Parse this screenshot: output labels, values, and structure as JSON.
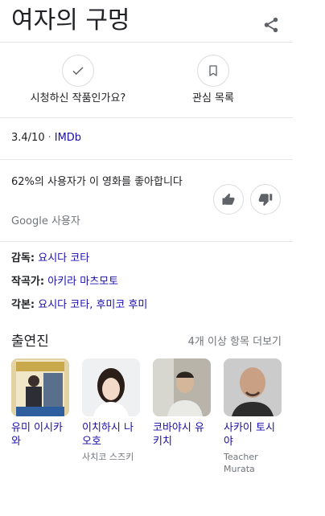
{
  "header": {
    "title": "여자의 구멍",
    "share_icon": "share-icon"
  },
  "actions": [
    {
      "label": "시청하신 작품인가요?",
      "icon": "checkmark-icon"
    },
    {
      "label": "관심 목록",
      "icon": "bookmark-icon"
    }
  ],
  "rating": {
    "score": "3.4/10",
    "separator": "·",
    "source": "IMDb"
  },
  "audience": {
    "text": "62%의 사용자가 이 영화를 좋아합니다",
    "source": "Google 사용자",
    "like_icon": "thumbs-up-icon",
    "dislike_icon": "thumbs-down-icon"
  },
  "credits": [
    {
      "key": "감독:",
      "value": "요시다 코타"
    },
    {
      "key": "작곡가:",
      "value": "아키라 마츠모토"
    },
    {
      "key": "각본:",
      "value": "요시다 코타, 후미코 후미"
    }
  ],
  "cast": {
    "heading": "출연진",
    "more_link": "4개 이상 항목 더보기",
    "members": [
      {
        "name": "유미 이시카와",
        "role": ""
      },
      {
        "name": "이치하시 나오호",
        "role": "사치코 스즈키"
      },
      {
        "name": "코바야시 유키치",
        "role": ""
      },
      {
        "name": "사카이 토시야",
        "role": "Teacher Murata"
      }
    ]
  },
  "colors": {
    "link": "#1a0dab",
    "muted": "#70757a",
    "border": "#dadce0"
  }
}
